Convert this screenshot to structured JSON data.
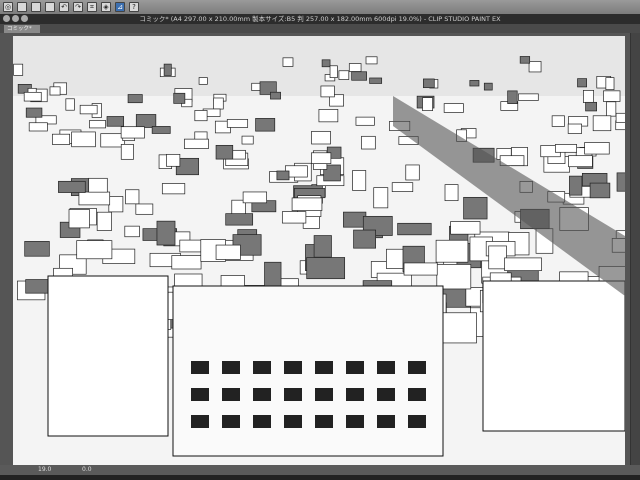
{
  "window": {
    "title": "コミック* (A4 297.00 x 210.00mm 製本サイズ:B5 判 257.00 x 182.00mm 600dpi 19.0%) - CLIP STUDIO PAINT EX"
  },
  "tabs": [
    {
      "label": "コミック*"
    }
  ],
  "status": {
    "zoom": "19.0",
    "angle": "0.0"
  },
  "toolbar": {
    "icons": [
      "app-icon",
      "new-icon",
      "open-icon",
      "save-icon",
      "undo-icon",
      "redo-icon",
      "transform-icon",
      "fill-icon",
      "ruler-icon",
      "help-icon"
    ]
  }
}
